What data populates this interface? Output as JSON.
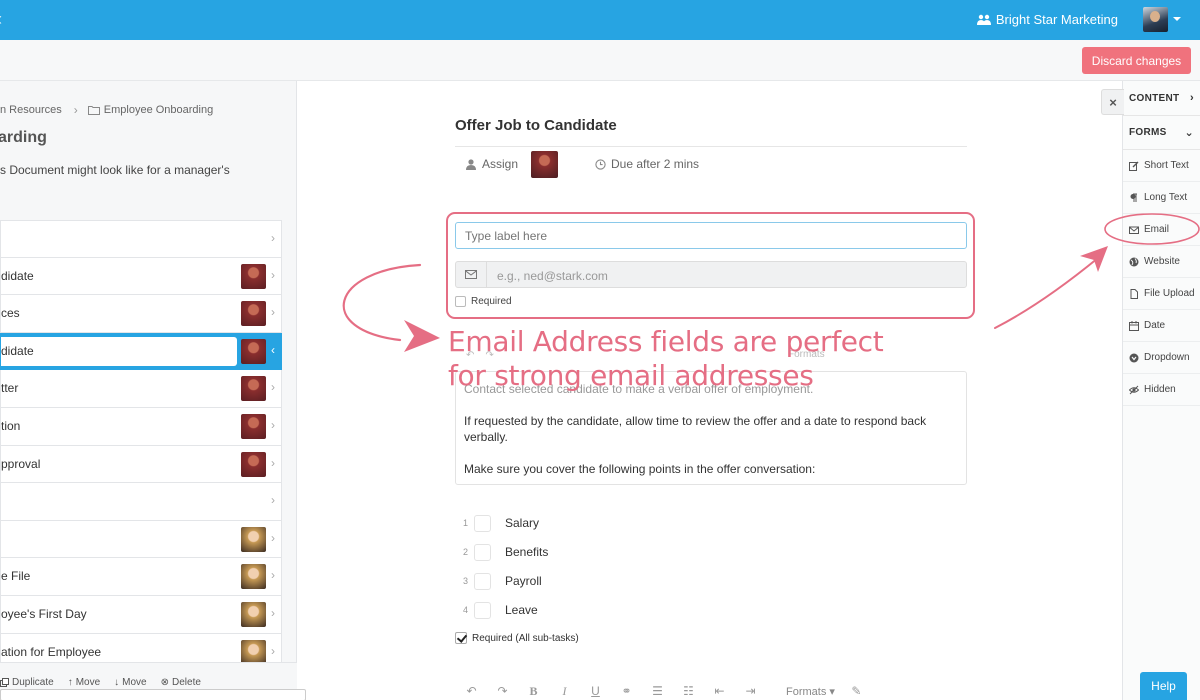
{
  "topbar": {
    "back_glyph": "‹",
    "org_name": "Bright Star Marketing",
    "org_icon": "users-icon"
  },
  "subbar": {
    "discard_label": "Discard changes"
  },
  "leftpanel": {
    "breadcrumb": [
      "n Resources",
      "Employee Onboarding"
    ],
    "title": "arding",
    "description": "s Document might look like for a manager's",
    "tasks": [
      {
        "label": "",
        "thumb": "none"
      },
      {
        "label": "didate",
        "thumb": "red"
      },
      {
        "label": "ces",
        "thumb": "red"
      },
      {
        "label": "didate",
        "thumb": "red",
        "active": true
      },
      {
        "label": "tter",
        "thumb": "red"
      },
      {
        "label": "tion",
        "thumb": "red"
      },
      {
        "label": "pproval",
        "thumb": "red"
      },
      {
        "label": "",
        "thumb": "none"
      },
      {
        "label": "",
        "thumb": "blonde"
      },
      {
        "label": "e File",
        "thumb": "blonde"
      },
      {
        "label": "oyee's First Day",
        "thumb": "blonde"
      },
      {
        "label": "ation for Employee",
        "thumb": "blonde"
      }
    ],
    "footer_actions": [
      "Duplicate",
      "Move",
      "Move",
      "Delete"
    ]
  },
  "main": {
    "title": "Offer Job to Candidate",
    "assign_label": "Assign",
    "due_label": "Due after 2 mins",
    "label_input_placeholder": "Type label here",
    "email_placeholder": "e.g., ned@stark.com",
    "required_label": "Required",
    "annotation_line1": "Email Address fields are perfect",
    "annotation_line2": "for strong email addresses",
    "ghost_formats": "Formats",
    "description": {
      "p0": "Contact selected candidate to make a verbal offer of employment.",
      "p1": "If requested by the candidate, allow time to review the offer and a date to respond back verbally.",
      "p2": "Make sure you cover the following points in the offer conversation:"
    },
    "subtasks": [
      {
        "num": "1",
        "label": "Salary"
      },
      {
        "num": "2",
        "label": "Benefits"
      },
      {
        "num": "3",
        "label": "Payroll"
      },
      {
        "num": "4",
        "label": "Leave"
      }
    ],
    "required_subtasks_label": "Required (All sub-tasks)",
    "toolbar_formats": "Formats"
  },
  "rightpanel": {
    "close_glyph": "×",
    "content_label": "CONTENT",
    "forms_label": "FORMS",
    "items": [
      {
        "label": "Short Text",
        "icon": "pencil-icon"
      },
      {
        "label": "Long Text",
        "icon": "paragraph-icon"
      },
      {
        "label": "Email",
        "icon": "envelope-icon"
      },
      {
        "label": "Website",
        "icon": "globe-icon"
      },
      {
        "label": "File Upload",
        "icon": "file-icon"
      },
      {
        "label": "Date",
        "icon": "calendar-icon"
      },
      {
        "label": "Dropdown",
        "icon": "dropdown-icon"
      },
      {
        "label": "Hidden",
        "icon": "eye-slash-icon"
      }
    ],
    "help_label": "Help"
  },
  "colors": {
    "primary": "#27a4e2",
    "danger": "#f0727d",
    "annotation": "#e56e84"
  }
}
